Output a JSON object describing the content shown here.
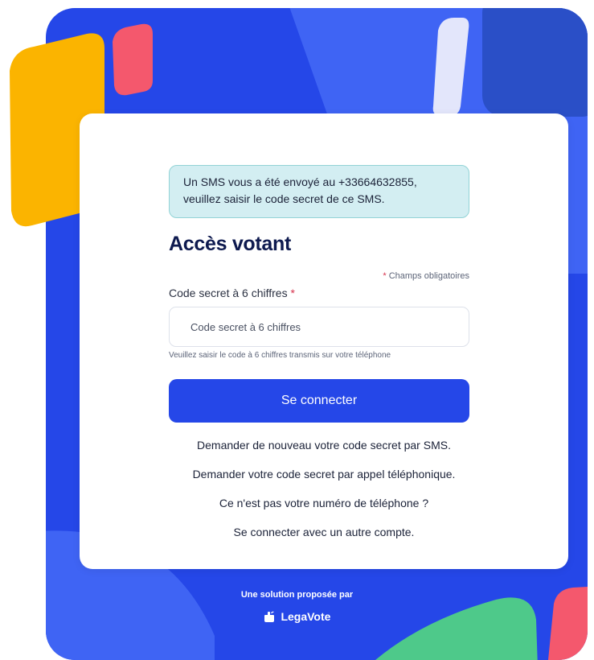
{
  "colors": {
    "brand_blue": "#2547e8",
    "dark_navy": "#0e1a4f",
    "alert_bg": "#d3eef2",
    "required_red": "#d6304c",
    "deco_yellow": "#fbb400",
    "deco_pink": "#f4586d",
    "deco_green": "#4ec98a"
  },
  "alert": {
    "message_line1": "Un SMS vous a été envoyé au +33664632855,",
    "message_line2": "veuillez saisir le code secret de ce SMS."
  },
  "form": {
    "title": "Accès votant",
    "required_star": "*",
    "required_note": "Champs obligatoires",
    "code_label": "Code secret à 6 chiffres",
    "code_placeholder": "Code secret à 6 chiffres",
    "code_value": "",
    "code_help": "Veuillez saisir le code à 6 chiffres transmis sur votre téléphone",
    "submit_label": "Se connecter"
  },
  "links": {
    "resend_sms": "Demander de nouveau votre code secret par SMS.",
    "request_call": "Demander votre code secret par appel téléphonique.",
    "wrong_number": "Ce n'est pas votre numéro de téléphone ?",
    "other_account": "Se connecter avec un autre compte."
  },
  "footer": {
    "tagline": "Une solution proposée par",
    "brand_name": "LegaVote",
    "brand_icon": "legavote-logo-icon"
  }
}
